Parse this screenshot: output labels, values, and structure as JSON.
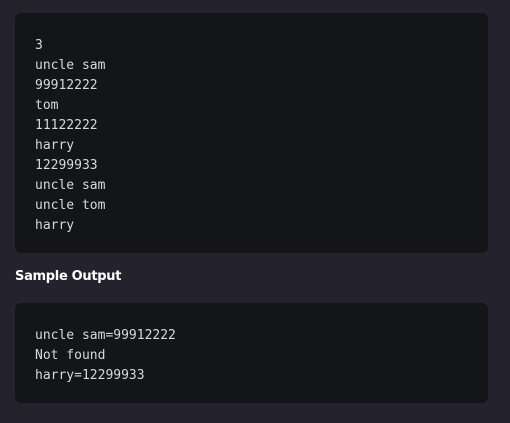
{
  "sample_input": {
    "lines": [
      "3",
      "uncle sam",
      "99912222",
      "tom",
      "11122222",
      "harry",
      "12299933",
      "uncle sam",
      "uncle tom",
      "harry"
    ]
  },
  "sample_output": {
    "heading": "Sample Output",
    "lines": [
      "uncle sam=99912222",
      "Not found",
      "harry=12299933"
    ]
  }
}
